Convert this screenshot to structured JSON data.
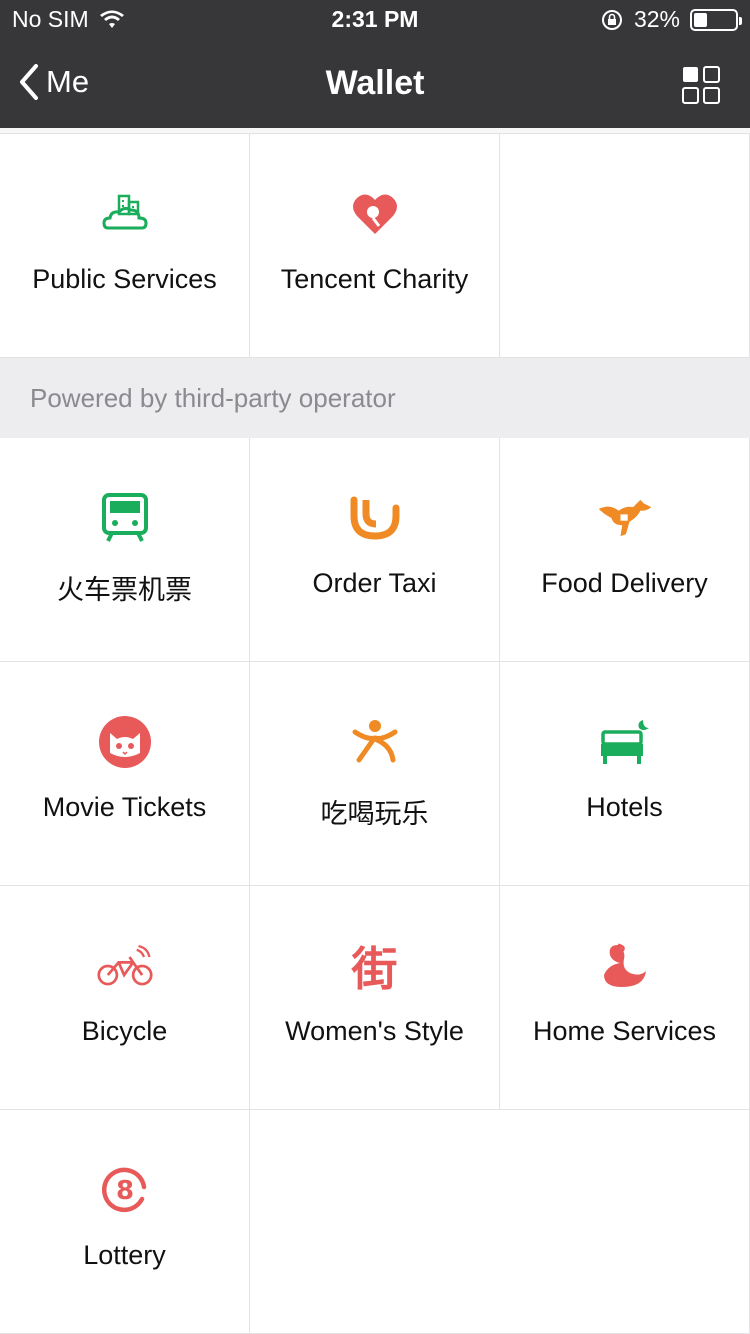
{
  "status_bar": {
    "carrier": "No SIM",
    "time": "2:31 PM",
    "battery_text": "32%",
    "battery_level": 0.32
  },
  "nav": {
    "back_label": "Me",
    "title": "Wallet"
  },
  "top_services": [
    {
      "label": "Public Services",
      "icon": "public-services-icon",
      "color": "#1aad5c"
    },
    {
      "label": "Tencent Charity",
      "icon": "charity-heart-icon",
      "color": "#e85a5a"
    }
  ],
  "section_header": "Powered by third-party operator",
  "third_party_services": [
    {
      "label": "火车票机票",
      "icon": "train-icon",
      "color": "#1aad5c"
    },
    {
      "label": "Order Taxi",
      "icon": "didi-taxi-icon",
      "color": "#f08a24"
    },
    {
      "label": "Food Delivery",
      "icon": "kangaroo-icon",
      "color": "#f08a24"
    },
    {
      "label": "Movie Tickets",
      "icon": "cat-icon",
      "color": "#e85a5a"
    },
    {
      "label": "吃喝玩乐",
      "icon": "person-icon",
      "color": "#f08a24"
    },
    {
      "label": "Hotels",
      "icon": "bed-icon",
      "color": "#1aad5c"
    },
    {
      "label": "Bicycle",
      "icon": "bicycle-icon",
      "color": "#e85a5a"
    },
    {
      "label": "Women's Style",
      "icon": "jie-character-icon",
      "color": "#e85a5a"
    },
    {
      "label": "Home Services",
      "icon": "swan-icon",
      "color": "#e85a5a"
    },
    {
      "label": "Lottery",
      "icon": "lottery-8-icon",
      "color": "#e85a5a"
    }
  ]
}
